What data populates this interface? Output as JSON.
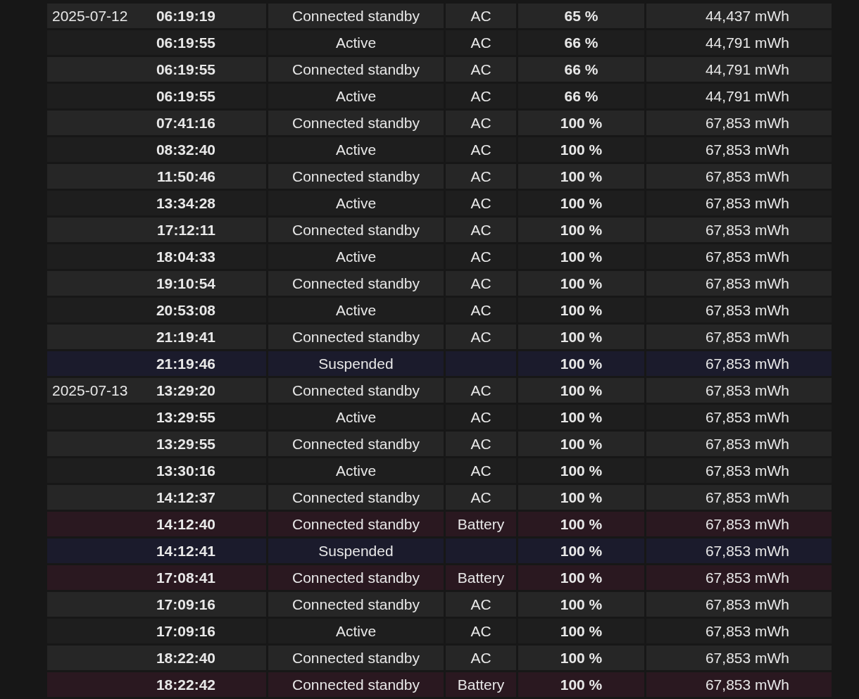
{
  "rows": [
    {
      "date": "2025-07-12",
      "time": "06:19:19",
      "state": "Connected standby",
      "source": "AC",
      "percent": "65 %",
      "capacity": "44,437 mWh",
      "kind": "ac"
    },
    {
      "time": "06:19:55",
      "state": "Active",
      "source": "AC",
      "percent": "66 %",
      "capacity": "44,791 mWh",
      "kind": "ac"
    },
    {
      "time": "06:19:55",
      "state": "Connected standby",
      "source": "AC",
      "percent": "66 %",
      "capacity": "44,791 mWh",
      "kind": "ac"
    },
    {
      "time": "06:19:55",
      "state": "Active",
      "source": "AC",
      "percent": "66 %",
      "capacity": "44,791 mWh",
      "kind": "ac"
    },
    {
      "time": "07:41:16",
      "state": "Connected standby",
      "source": "AC",
      "percent": "100 %",
      "capacity": "67,853 mWh",
      "kind": "ac"
    },
    {
      "time": "08:32:40",
      "state": "Active",
      "source": "AC",
      "percent": "100 %",
      "capacity": "67,853 mWh",
      "kind": "ac"
    },
    {
      "time": "11:50:46",
      "state": "Connected standby",
      "source": "AC",
      "percent": "100 %",
      "capacity": "67,853 mWh",
      "kind": "ac"
    },
    {
      "time": "13:34:28",
      "state": "Active",
      "source": "AC",
      "percent": "100 %",
      "capacity": "67,853 mWh",
      "kind": "ac"
    },
    {
      "time": "17:12:11",
      "state": "Connected standby",
      "source": "AC",
      "percent": "100 %",
      "capacity": "67,853 mWh",
      "kind": "ac"
    },
    {
      "time": "18:04:33",
      "state": "Active",
      "source": "AC",
      "percent": "100 %",
      "capacity": "67,853 mWh",
      "kind": "ac"
    },
    {
      "time": "19:10:54",
      "state": "Connected standby",
      "source": "AC",
      "percent": "100 %",
      "capacity": "67,853 mWh",
      "kind": "ac"
    },
    {
      "time": "20:53:08",
      "state": "Active",
      "source": "AC",
      "percent": "100 %",
      "capacity": "67,853 mWh",
      "kind": "ac"
    },
    {
      "time": "21:19:41",
      "state": "Connected standby",
      "source": "AC",
      "percent": "100 %",
      "capacity": "67,853 mWh",
      "kind": "ac"
    },
    {
      "time": "21:19:46",
      "state": "Suspended",
      "percent": "100 %",
      "capacity": "67,853 mWh",
      "kind": "suspended"
    },
    {
      "date": "2025-07-13",
      "time": "13:29:20",
      "state": "Connected standby",
      "source": "AC",
      "percent": "100 %",
      "capacity": "67,853 mWh",
      "kind": "ac"
    },
    {
      "time": "13:29:55",
      "state": "Active",
      "source": "AC",
      "percent": "100 %",
      "capacity": "67,853 mWh",
      "kind": "ac"
    },
    {
      "time": "13:29:55",
      "state": "Connected standby",
      "source": "AC",
      "percent": "100 %",
      "capacity": "67,853 mWh",
      "kind": "ac"
    },
    {
      "time": "13:30:16",
      "state": "Active",
      "source": "AC",
      "percent": "100 %",
      "capacity": "67,853 mWh",
      "kind": "ac"
    },
    {
      "time": "14:12:37",
      "state": "Connected standby",
      "source": "AC",
      "percent": "100 %",
      "capacity": "67,853 mWh",
      "kind": "ac"
    },
    {
      "time": "14:12:40",
      "state": "Connected standby",
      "source": "Battery",
      "percent": "100 %",
      "capacity": "67,853 mWh",
      "kind": "battery"
    },
    {
      "time": "14:12:41",
      "state": "Suspended",
      "percent": "100 %",
      "capacity": "67,853 mWh",
      "kind": "suspended"
    },
    {
      "time": "17:08:41",
      "state": "Connected standby",
      "source": "Battery",
      "percent": "100 %",
      "capacity": "67,853 mWh",
      "kind": "battery"
    },
    {
      "time": "17:09:16",
      "state": "Connected standby",
      "source": "AC",
      "percent": "100 %",
      "capacity": "67,853 mWh",
      "kind": "ac"
    },
    {
      "time": "17:09:16",
      "state": "Active",
      "source": "AC",
      "percent": "100 %",
      "capacity": "67,853 mWh",
      "kind": "ac"
    },
    {
      "time": "18:22:40",
      "state": "Connected standby",
      "source": "AC",
      "percent": "100 %",
      "capacity": "67,853 mWh",
      "kind": "ac"
    },
    {
      "time": "18:22:42",
      "state": "Connected standby",
      "source": "Battery",
      "percent": "100 %",
      "capacity": "67,853 mWh",
      "kind": "battery"
    }
  ]
}
